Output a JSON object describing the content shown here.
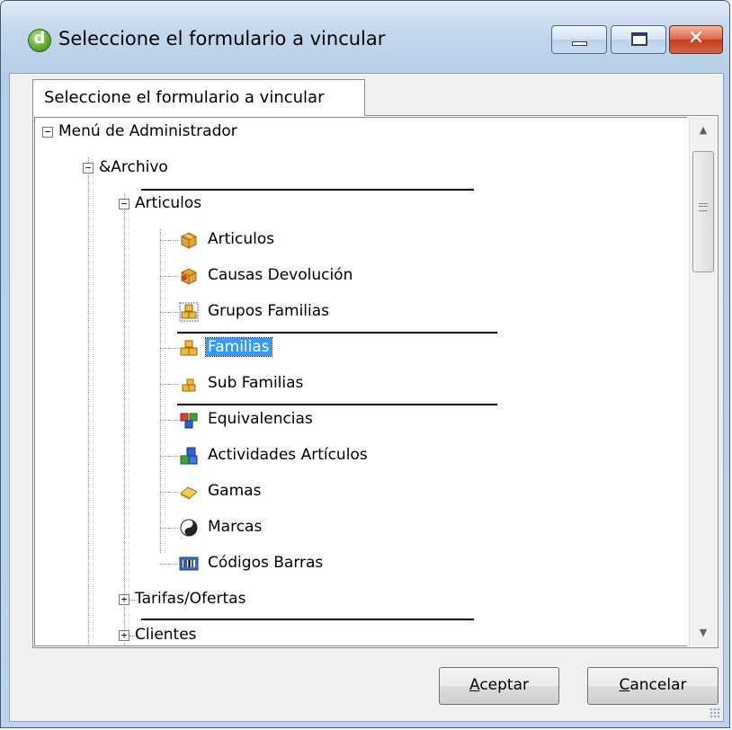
{
  "window": {
    "title": "Seleccione el formulario a vincular",
    "app_icon_letter": "d"
  },
  "tab": {
    "label": "Seleccione el formulario a vincular"
  },
  "tree": {
    "items": [
      {
        "label": "Menú de Administrador",
        "expander": "−"
      },
      {
        "label": "&Archivo",
        "expander": "−"
      },
      {
        "label": "Articulos",
        "expander": "−"
      },
      {
        "label": "Articulos",
        "icon": "box-icon"
      },
      {
        "label": "Causas Devolución",
        "icon": "box-return-icon"
      },
      {
        "label": "Grupos Familias",
        "icon": "boxes-group-icon"
      },
      {
        "label": "Familias",
        "icon": "boxes-icon",
        "selected": true
      },
      {
        "label": "Sub Familias",
        "icon": "boxes-small-icon"
      },
      {
        "label": "Equivalencias",
        "icon": "equivalence-icon"
      },
      {
        "label": "Actividades Artículos",
        "icon": "blocks-icon"
      },
      {
        "label": "Gamas",
        "icon": "bar-gold-icon"
      },
      {
        "label": "Marcas",
        "icon": "yin-yang-icon"
      },
      {
        "label": "Códigos Barras",
        "icon": "barcode-icon"
      },
      {
        "label": "Tarifas/Ofertas",
        "expander": "+"
      },
      {
        "label": "Clientes",
        "expander": "+"
      }
    ]
  },
  "buttons": {
    "ok": {
      "accel": "A",
      "rest": "ceptar"
    },
    "cancel": {
      "accel": "C",
      "rest": "ancelar"
    }
  },
  "colors": {
    "selection": "#3399ff",
    "close_button": "#c23c1c"
  }
}
